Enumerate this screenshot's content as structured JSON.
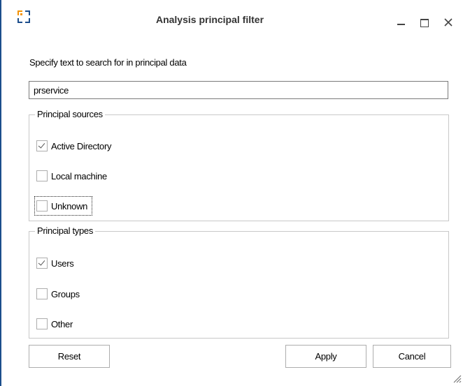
{
  "window": {
    "title": "Analysis principal filter",
    "minimize_icon": "minimize-icon",
    "maximize_icon": "maximize-icon",
    "close_icon": "close-icon",
    "accent": "#1c4e8c",
    "app_icon_color": "#f39200"
  },
  "search": {
    "prompt": "Specify text to search for in principal data",
    "value": "prservice"
  },
  "sources": {
    "legend": "Principal sources",
    "items": [
      {
        "label": "Active Directory",
        "checked": true
      },
      {
        "label": "Local machine",
        "checked": false
      },
      {
        "label": "Unknown",
        "checked": false,
        "focused": true
      }
    ]
  },
  "types": {
    "legend": "Principal types",
    "items": [
      {
        "label": "Users",
        "checked": true
      },
      {
        "label": "Groups",
        "checked": false
      },
      {
        "label": "Other",
        "checked": false
      }
    ]
  },
  "buttons": {
    "reset": "Reset",
    "apply": "Apply",
    "cancel": "Cancel"
  }
}
